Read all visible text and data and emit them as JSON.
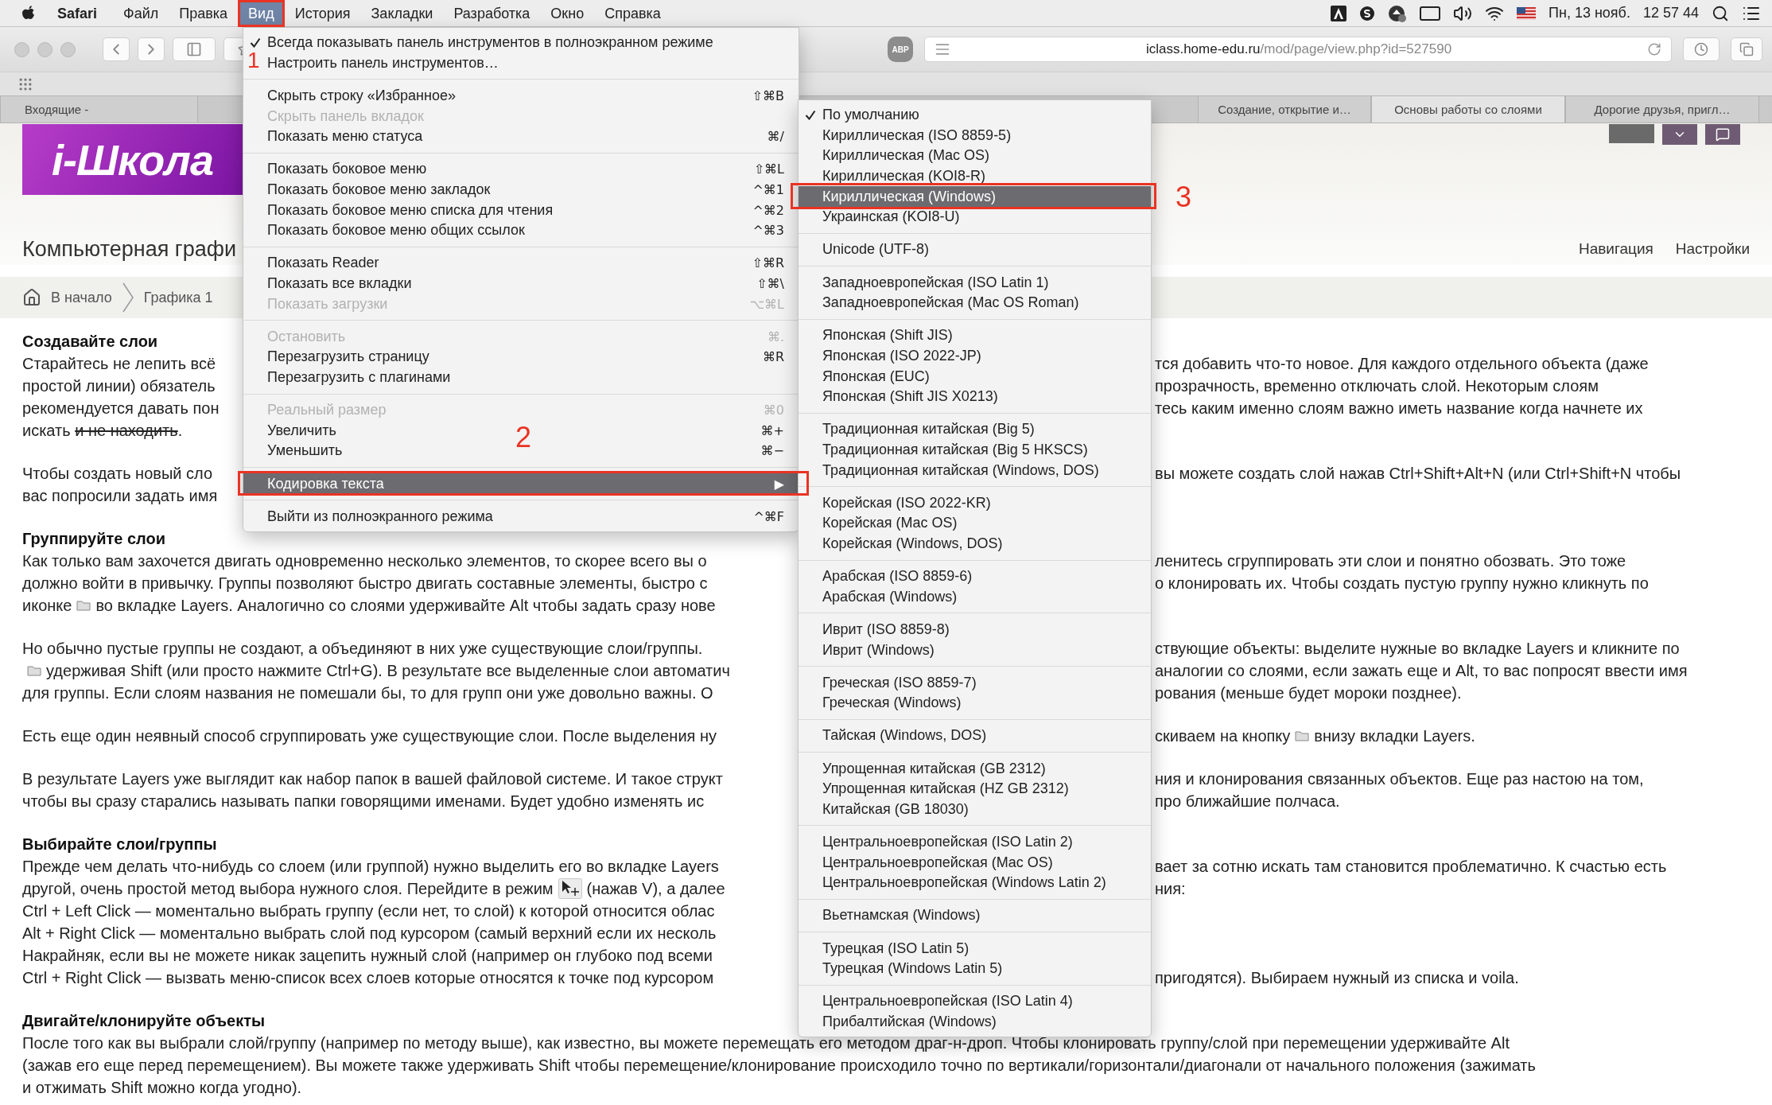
{
  "menubar": {
    "app": "Safari",
    "items": [
      {
        "label": "Файл",
        "selected": false
      },
      {
        "label": "Правка",
        "selected": false
      },
      {
        "label": "Вид",
        "selected": true
      },
      {
        "label": "История",
        "selected": false
      },
      {
        "label": "Закладки",
        "selected": false
      },
      {
        "label": "Разработка",
        "selected": false
      },
      {
        "label": "Окно",
        "selected": false
      },
      {
        "label": "Справка",
        "selected": false
      }
    ],
    "date": "Пн, 13 нояб.",
    "time": "12 57 44"
  },
  "toolbar": {
    "adblock_label": "ABP",
    "url_host": "iclass.home-edu.ru",
    "url_path": "/mod/page/view.php?id=527590"
  },
  "tabs_left": [
    {
      "label": "Входящие -",
      "selected": false
    }
  ],
  "tabs_right": [
    {
      "label": "Создание, открытие и…",
      "selected": false
    },
    {
      "label": "Основы работы со слоями",
      "selected": true
    },
    {
      "label": "Дорогие друзья, пригл…",
      "selected": false
    }
  ],
  "site": {
    "logo": "i-Школа",
    "course_title": "Компьютерная графи",
    "nav": [
      "Навигация",
      "Настройки"
    ],
    "breadcrumbs": [
      "В начало",
      "Графика 1"
    ]
  },
  "article": [
    {
      "kind": "heading",
      "text": "Создавайте слои"
    },
    {
      "kind": "paragraph",
      "lines": [
        {
          "left": [
            "Старайтесь не лепить всё"
          ],
          "right": [
            "тся добавить что-то новое. Для каждого отдельного объекта (даже"
          ]
        },
        {
          "left": [
            "простой линии) обязатель"
          ],
          "right": [
            "прозрачность, временно отключать слой. Некоторым слоям"
          ]
        },
        {
          "left": [
            "рекомендуется давать пон"
          ],
          "right": [
            "тесь каким именно слоям важно иметь название когда начнете их"
          ]
        },
        {
          "left": [
            "искать ",
            {
              "kind": "struck",
              "text": "и не находить"
            },
            "."
          ]
        }
      ]
    },
    {
      "kind": "paragraph",
      "lines": [
        {
          "left": [
            "Чтобы создать новый сло"
          ],
          "right": [
            "вы можете создать слой нажав Ctrl+Shift+Alt+N (или Ctrl+Shift+N чтобы"
          ]
        },
        {
          "left": [
            "вас попросили задать имя"
          ]
        }
      ]
    },
    {
      "kind": "heading",
      "text": "Группируйте слои"
    },
    {
      "kind": "paragraph",
      "lines": [
        {
          "left": [
            "Как только вам захочется двигать одновременно несколько элементов, то скорее всего вы о"
          ],
          "right": [
            "ленитесь сгруппировать эти слои и понятно обозвать. Это тоже"
          ]
        },
        {
          "left": [
            "должно войти в привычку. Группы позволяют быстро двигать составные элементы, быстро с"
          ],
          "right": [
            "о клонировать их. Чтобы создать пустую группу нужно кликнуть по"
          ]
        },
        {
          "left": [
            "иконке",
            {
              "kind": "folder"
            },
            "во вкладке Layers. Аналогично со слоями удерживайте Alt чтобы задать сразу нове"
          ]
        }
      ]
    },
    {
      "kind": "paragraph",
      "lines": [
        {
          "left": [
            "Но обычно пустые группы не создают, а объединяют в них уже существующие слои/группы."
          ],
          "right": [
            "ствующие объекты: выделите нужные во вкладке Layers и кликните по"
          ]
        },
        {
          "left": [
            {
              "kind": "folder"
            },
            "удерживая Shift (или просто нажмите Ctrl+G). В результате все выделенные слои автоматич"
          ],
          "right": [
            "аналогии со слоями, если зажать еще и Alt, то вас попросят ввести имя"
          ]
        },
        {
          "left": [
            "для группы. Если слоям названия не помешали бы, то для групп они уже довольно важны. О"
          ],
          "right": [
            "рования (меньше будет мороки позднее)."
          ]
        }
      ]
    },
    {
      "kind": "paragraph",
      "lines": [
        {
          "left": [
            "Есть еще один неявный способ сгруппировать уже существующие слои. После выделения ну"
          ],
          "right": [
            "скиваем на кнопку",
            {
              "kind": "folder"
            },
            "внизу вкладки Layers."
          ]
        }
      ]
    },
    {
      "kind": "paragraph",
      "lines": [
        {
          "left": [
            "В результате Layers уже выглядит как набор папок в вашей файловой системе. И такое структ"
          ],
          "right": [
            "ния и клонирования связанных объектов. Еще раз настою на том,"
          ]
        },
        {
          "left": [
            "чтобы вы сразу старались называть папки говорящими именами. Будет удобно изменять ис"
          ],
          "right": [
            "про ближайшие полчаса."
          ]
        }
      ]
    },
    {
      "kind": "heading",
      "text": "Выбирайте слои/группы"
    },
    {
      "kind": "paragraph",
      "lines": [
        {
          "left": [
            "Прежде чем делать что-нибудь со слоем (или группой) нужно выделить его во вкладке Layers"
          ],
          "right": [
            "вает за сотню искать там становится проблематично. К счастью есть"
          ]
        },
        {
          "left": [
            "другой, очень простой метод выбора нужного слоя. Перейдите в режим",
            {
              "kind": "movetool"
            },
            "(нажав V), а далее"
          ],
          "right": [
            "ния:"
          ]
        },
        {
          "left": [
            "Ctrl + Left Click — моментально выбрать группу (если нет, то слой) к которой относится облас"
          ]
        },
        {
          "left": [
            "Alt + Right Click — моментально выбрать слой под курсором (самый верхний если их несколь"
          ]
        },
        {
          "left": [
            "Накрайняк, если вы не можете никак зацепить нужный слой (например он глубоко под всеми"
          ]
        },
        {
          "left": [
            "Ctrl + Right Click — вызвать меню-список всех слоев которые относятся к точке под курсором"
          ],
          "right": [
            "пригодятся). Выбираем нужный из списка и voila."
          ]
        }
      ]
    },
    {
      "kind": "heading",
      "text": "Двигайте/клонируйте объекты"
    },
    {
      "kind": "paragraph",
      "lines": [
        {
          "full": [
            "После того как вы выбрали слой/группу (например по методу выше), как известно, вы можете перемещать его методом драг-н-дроп. Чтобы клонировать группу/слой при перемещении удерживайте Alt"
          ]
        },
        {
          "full": [
            "(зажав его еще перед перемещением). Вы можете также удерживать Shift чтобы перемещение/клонирование происходило точно по вертикали/горизонтали/диагонали от начального положения (зажимать"
          ]
        },
        {
          "full": [
            "и отжимать Shift можно когда угодно)."
          ]
        }
      ]
    }
  ],
  "view_menu": {
    "items": [
      {
        "kind": "item",
        "label": "Всегда показывать панель инструментов в полноэкранном режиме",
        "checked": true,
        "disabled": false,
        "selected": false
      },
      {
        "kind": "item",
        "label": "Настроить панель инструментов…",
        "checked": false,
        "disabled": false,
        "selected": false
      },
      {
        "kind": "separator"
      },
      {
        "kind": "item",
        "label": "Скрыть строку «Избранное»",
        "shortcut": "⇧⌘B",
        "checked": false,
        "disabled": false,
        "selected": false
      },
      {
        "kind": "item",
        "label": "Скрыть панель вкладок",
        "checked": false,
        "disabled": true,
        "selected": false
      },
      {
        "kind": "item",
        "label": "Показать меню статуса",
        "shortcut": "⌘/",
        "checked": false,
        "disabled": false,
        "selected": false
      },
      {
        "kind": "separator"
      },
      {
        "kind": "item",
        "label": "Показать боковое меню",
        "shortcut": "⇧⌘L",
        "checked": false,
        "disabled": false,
        "selected": false
      },
      {
        "kind": "item",
        "label": "Показать боковое меню закладок",
        "shortcut": "^⌘1",
        "checked": false,
        "disabled": false,
        "selected": false
      },
      {
        "kind": "item",
        "label": "Показать боковое меню списка для чтения",
        "shortcut": "^⌘2",
        "checked": false,
        "disabled": false,
        "selected": false
      },
      {
        "kind": "item",
        "label": "Показать боковое меню общих ссылок",
        "shortcut": "^⌘3",
        "checked": false,
        "disabled": false,
        "selected": false
      },
      {
        "kind": "separator"
      },
      {
        "kind": "item",
        "label": "Показать Reader",
        "shortcut": "⇧⌘R",
        "checked": false,
        "disabled": false,
        "selected": false
      },
      {
        "kind": "item",
        "label": "Показать все вкладки",
        "shortcut": "⇧⌘\\",
        "checked": false,
        "disabled": false,
        "selected": false
      },
      {
        "kind": "item",
        "label": "Показать загрузки",
        "shortcut": "⌥⌘L",
        "checked": false,
        "disabled": true,
        "selected": false
      },
      {
        "kind": "separator"
      },
      {
        "kind": "item",
        "label": "Остановить",
        "shortcut": "⌘.",
        "checked": false,
        "disabled": true,
        "selected": false
      },
      {
        "kind": "item",
        "label": "Перезагрузить страницу",
        "shortcut": "⌘R",
        "checked": false,
        "disabled": false,
        "selected": false
      },
      {
        "kind": "item",
        "label": "Перезагрузить с плагинами",
        "checked": false,
        "disabled": false,
        "selected": false
      },
      {
        "kind": "separator"
      },
      {
        "kind": "item",
        "label": "Реальный размер",
        "shortcut": "⌘0",
        "checked": false,
        "disabled": true,
        "selected": false
      },
      {
        "kind": "item",
        "label": "Увеличить",
        "shortcut": "⌘+",
        "checked": false,
        "disabled": false,
        "selected": false
      },
      {
        "kind": "item",
        "label": "Уменьшить",
        "shortcut": "⌘−",
        "checked": false,
        "disabled": false,
        "selected": false
      },
      {
        "kind": "separator"
      },
      {
        "kind": "item",
        "label": "Кодировка текста",
        "arrow": "▶",
        "checked": false,
        "disabled": false,
        "selected": true
      },
      {
        "kind": "separator"
      },
      {
        "kind": "item",
        "label": "Выйти из полноэкранного режима",
        "shortcut": "^⌘F",
        "checked": false,
        "disabled": false,
        "selected": false
      }
    ]
  },
  "encoding_menu": {
    "items": [
      {
        "kind": "item",
        "label": "По умолчанию",
        "checked": true,
        "disabled": false,
        "selected": false
      },
      {
        "kind": "item",
        "label": "Кириллическая (ISO 8859-5)",
        "checked": false,
        "disabled": false,
        "selected": false
      },
      {
        "kind": "item",
        "label": "Кириллическая (Mac OS)",
        "checked": false,
        "disabled": false,
        "selected": false
      },
      {
        "kind": "item",
        "label": "Кириллическая (KOI8-R)",
        "checked": false,
        "disabled": false,
        "selected": false
      },
      {
        "kind": "item",
        "label": "Кириллическая (Windows)",
        "checked": false,
        "disabled": false,
        "selected": true
      },
      {
        "kind": "item",
        "label": "Украинская (KOI8-U)",
        "checked": false,
        "disabled": false,
        "selected": false
      },
      {
        "kind": "separator"
      },
      {
        "kind": "item",
        "label": "Unicode (UTF-8)",
        "checked": false,
        "disabled": false,
        "selected": false
      },
      {
        "kind": "separator"
      },
      {
        "kind": "item",
        "label": "Западноевропейская (ISO Latin 1)",
        "checked": false,
        "disabled": false,
        "selected": false
      },
      {
        "kind": "item",
        "label": "Западноевропейская (Mac OS Roman)",
        "checked": false,
        "disabled": false,
        "selected": false
      },
      {
        "kind": "separator"
      },
      {
        "kind": "item",
        "label": "Японская (Shift JIS)",
        "checked": false,
        "disabled": false,
        "selected": false
      },
      {
        "kind": "item",
        "label": "Японская (ISO 2022-JP)",
        "checked": false,
        "disabled": false,
        "selected": false
      },
      {
        "kind": "item",
        "label": "Японская (EUC)",
        "checked": false,
        "disabled": false,
        "selected": false
      },
      {
        "kind": "item",
        "label": "Японская (Shift JIS X0213)",
        "checked": false,
        "disabled": false,
        "selected": false
      },
      {
        "kind": "separator"
      },
      {
        "kind": "item",
        "label": "Традиционная китайская (Big 5)",
        "checked": false,
        "disabled": false,
        "selected": false
      },
      {
        "kind": "item",
        "label": "Традиционная китайская (Big 5 HKSCS)",
        "checked": false,
        "disabled": false,
        "selected": false
      },
      {
        "kind": "item",
        "label": "Традиционная китайская (Windows, DOS)",
        "checked": false,
        "disabled": false,
        "selected": false
      },
      {
        "kind": "separator"
      },
      {
        "kind": "item",
        "label": "Корейская (ISO 2022-KR)",
        "checked": false,
        "disabled": false,
        "selected": false
      },
      {
        "kind": "item",
        "label": "Корейская (Mac OS)",
        "checked": false,
        "disabled": false,
        "selected": false
      },
      {
        "kind": "item",
        "label": "Корейская (Windows, DOS)",
        "checked": false,
        "disabled": false,
        "selected": false
      },
      {
        "kind": "separator"
      },
      {
        "kind": "item",
        "label": "Арабская (ISO 8859-6)",
        "checked": false,
        "disabled": false,
        "selected": false
      },
      {
        "kind": "item",
        "label": "Арабская (Windows)",
        "checked": false,
        "disabled": false,
        "selected": false
      },
      {
        "kind": "separator"
      },
      {
        "kind": "item",
        "label": "Иврит (ISO 8859-8)",
        "checked": false,
        "disabled": false,
        "selected": false
      },
      {
        "kind": "item",
        "label": "Иврит (Windows)",
        "checked": false,
        "disabled": false,
        "selected": false
      },
      {
        "kind": "separator"
      },
      {
        "kind": "item",
        "label": "Греческая (ISO 8859-7)",
        "checked": false,
        "disabled": false,
        "selected": false
      },
      {
        "kind": "item",
        "label": "Греческая (Windows)",
        "checked": false,
        "disabled": false,
        "selected": false
      },
      {
        "kind": "separator"
      },
      {
        "kind": "item",
        "label": "Тайская (Windows, DOS)",
        "checked": false,
        "disabled": false,
        "selected": false
      },
      {
        "kind": "separator"
      },
      {
        "kind": "item",
        "label": "Упрощенная китайская (GB 2312)",
        "checked": false,
        "disabled": false,
        "selected": false
      },
      {
        "kind": "item",
        "label": "Упрощенная китайская (HZ GB 2312)",
        "checked": false,
        "disabled": false,
        "selected": false
      },
      {
        "kind": "item",
        "label": "Китайская (GB 18030)",
        "checked": false,
        "disabled": false,
        "selected": false
      },
      {
        "kind": "separator"
      },
      {
        "kind": "item",
        "label": "Центральноевропейская (ISO Latin 2)",
        "checked": false,
        "disabled": false,
        "selected": false
      },
      {
        "kind": "item",
        "label": "Центральноевропейская (Mac OS)",
        "checked": false,
        "disabled": false,
        "selected": false
      },
      {
        "kind": "item",
        "label": "Центральноевропейская (Windows Latin 2)",
        "checked": false,
        "disabled": false,
        "selected": false
      },
      {
        "kind": "separator"
      },
      {
        "kind": "item",
        "label": "Вьетнамская (Windows)",
        "checked": false,
        "disabled": false,
        "selected": false
      },
      {
        "kind": "separator"
      },
      {
        "kind": "item",
        "label": "Турецкая (ISO Latin 5)",
        "checked": false,
        "disabled": false,
        "selected": false
      },
      {
        "kind": "item",
        "label": "Турецкая (Windows Latin 5)",
        "checked": false,
        "disabled": false,
        "selected": false
      },
      {
        "kind": "separator"
      },
      {
        "kind": "item",
        "label": "Центральноевропейская (ISO Latin 4)",
        "checked": false,
        "disabled": false,
        "selected": false
      },
      {
        "kind": "item",
        "label": "Прибалтийская (Windows)",
        "checked": false,
        "disabled": false,
        "selected": false
      }
    ]
  },
  "annotations": [
    {
      "label": "1"
    },
    {
      "label": "2"
    },
    {
      "label": "3"
    }
  ]
}
